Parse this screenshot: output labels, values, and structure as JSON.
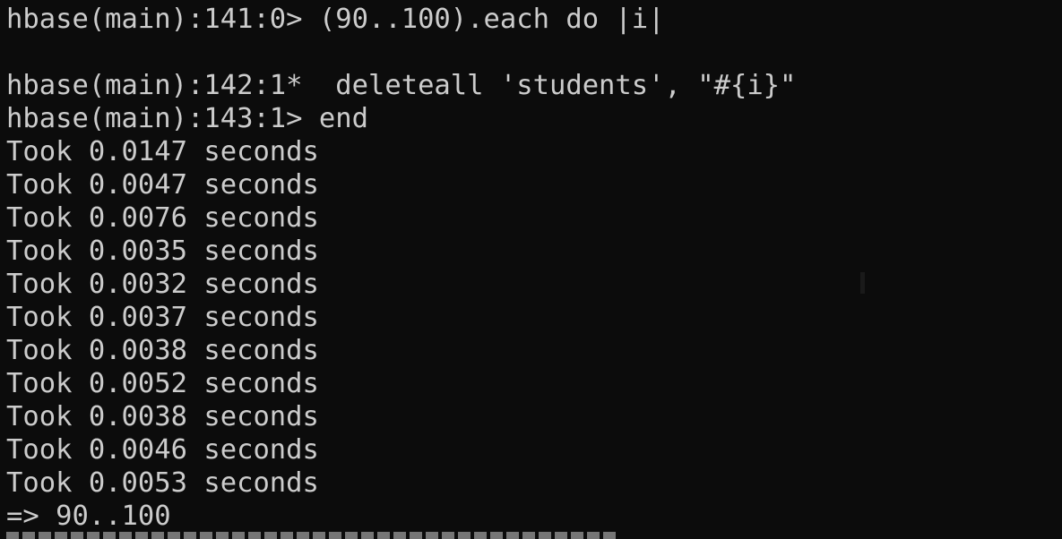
{
  "terminal": {
    "background": "#0c0c0c",
    "foreground": "#cccccc",
    "lines": [
      "hbase(main):141:0> (90..100).each do |i|",
      "",
      "hbase(main):142:1*  deleteall 'students', \"#{i}\"",
      "hbase(main):143:1> end",
      "Took 0.0147 seconds",
      "Took 0.0047 seconds",
      "Took 0.0076 seconds",
      "Took 0.0035 seconds",
      "Took 0.0032 seconds",
      "Took 0.0037 seconds",
      "Took 0.0038 seconds",
      "Took 0.0052 seconds",
      "Took 0.0038 seconds",
      "Took 0.0046 seconds",
      "Took 0.0053 seconds",
      "=> 90..100"
    ]
  }
}
